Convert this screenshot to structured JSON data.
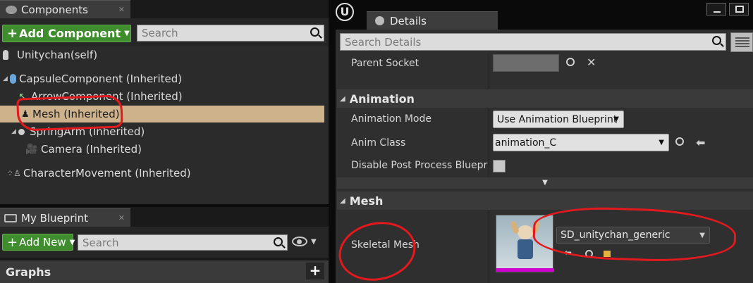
{
  "components_panel": {
    "tab_label": "Components",
    "add_button_label": "Add Component",
    "search_placeholder": "Search",
    "tree": [
      {
        "label": "Unitychan(self)"
      },
      {
        "label": "CapsuleComponent (Inherited)"
      },
      {
        "label": "ArrowComponent (Inherited)"
      },
      {
        "label": "Mesh (Inherited)"
      },
      {
        "label": "SpringArm (Inherited)"
      },
      {
        "label": "Camera (Inherited)"
      },
      {
        "label": "CharacterMovement (Inherited)"
      }
    ],
    "selected_item": "Mesh (Inherited)"
  },
  "blueprint_panel": {
    "tab_label": "My Blueprint",
    "add_button_label": "Add New",
    "search_placeholder": "Search",
    "graphs_label": "Graphs"
  },
  "details_panel": {
    "tab_label": "Details",
    "search_placeholder": "Search Details",
    "parent_socket_label": "Parent Socket",
    "animation_section": "Animation",
    "animation_mode_label": "Animation Mode",
    "animation_mode_value": "Use Animation Blueprint",
    "anim_class_label": "Anim Class",
    "anim_class_value": "animation_C",
    "disable_post_process_label": "Disable Post Process Blueprint",
    "mesh_section": "Mesh",
    "skeletal_mesh_label": "Skeletal Mesh",
    "skeletal_mesh_value": "SD_unitychan_generic"
  },
  "colors": {
    "selection": "#cdb28b",
    "green_button": "#3f8d2e",
    "annotation_red": "#e3191e"
  },
  "icons": [
    "components-icon",
    "close-icon",
    "search-icon",
    "eye-icon",
    "unreal-logo-icon",
    "details-icon",
    "browse-icon",
    "clear-icon",
    "use-selected-icon",
    "add-icon"
  ]
}
